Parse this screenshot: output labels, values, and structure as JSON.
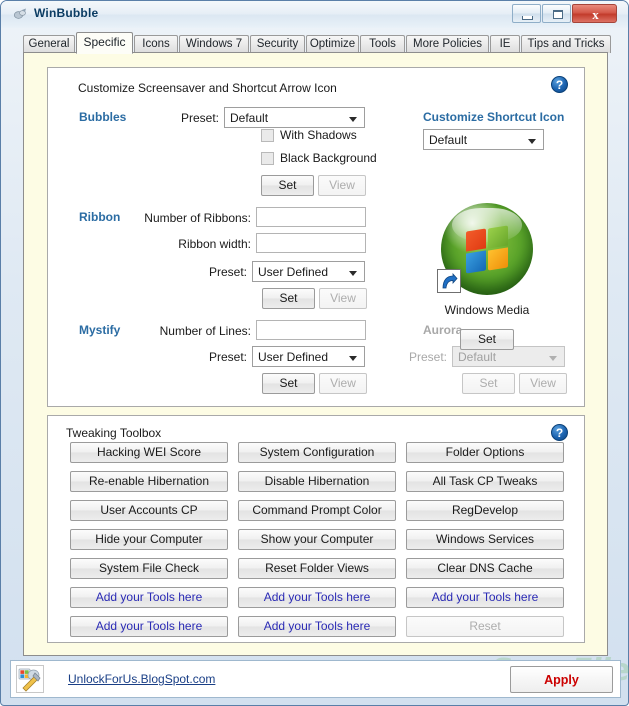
{
  "window": {
    "title": "WinBubble",
    "icon": "winbubble-app-icon",
    "controls": {
      "minimize": "minimize-icon",
      "maximize": "maximize-icon",
      "close": "x"
    }
  },
  "tabs": [
    {
      "label": "General",
      "active": false
    },
    {
      "label": "Specific",
      "active": true
    },
    {
      "label": "Icons",
      "active": false
    },
    {
      "label": "Windows 7",
      "active": false
    },
    {
      "label": "Security",
      "active": false
    },
    {
      "label": "Optimize",
      "active": false
    },
    {
      "label": "Tools",
      "active": false
    },
    {
      "label": "More Policies",
      "active": false
    },
    {
      "label": "IE",
      "active": false
    },
    {
      "label": "Tips and Tricks",
      "active": false
    }
  ],
  "screensaver_group": {
    "title": "Customize Screensaver and Shortcut Arrow Icon",
    "help": "?",
    "bubbles": {
      "label": "Bubbles",
      "preset_label": "Preset:",
      "preset_value": "Default",
      "checkboxes": [
        {
          "label": "With Shadows",
          "checked": false
        },
        {
          "label": "Black Background",
          "checked": false
        }
      ],
      "set_label": "Set",
      "view_label": "View",
      "view_disabled": true
    },
    "ribbon": {
      "label": "Ribbon",
      "count_label": "Number of Ribbons:",
      "count_value": "",
      "width_label": "Ribbon width:",
      "width_value": "",
      "preset_label": "Preset:",
      "preset_value": "User Defined",
      "set_label": "Set",
      "view_label": "View",
      "view_disabled": true
    },
    "mystify": {
      "label": "Mystify",
      "lines_label": "Number of Lines:",
      "lines_value": "",
      "preset_label": "Preset:",
      "preset_value": "User Defined",
      "set_label": "Set",
      "view_label": "View",
      "view_disabled": true
    },
    "shortcut": {
      "label": "Customize Shortcut Icon",
      "preset_value": "Default",
      "preview_icon": "windows-media-orb-icon",
      "badge_icon": "shortcut-arrow-icon",
      "caption": "Windows Media",
      "set_label": "Set"
    },
    "aurora": {
      "label": "Aurora",
      "disabled": true,
      "preset_label": "Preset:",
      "preset_value": "Default",
      "set_label": "Set",
      "view_label": "View"
    }
  },
  "toolbox_group": {
    "title": "Tweaking Toolbox",
    "help": "?",
    "buttons": [
      {
        "label": "Hacking WEI Score",
        "style": "normal"
      },
      {
        "label": "System Configuration",
        "style": "normal"
      },
      {
        "label": "Folder Options",
        "style": "normal"
      },
      {
        "label": "Re-enable Hibernation",
        "style": "normal"
      },
      {
        "label": "Disable Hibernation",
        "style": "normal"
      },
      {
        "label": "All Task CP Tweaks",
        "style": "normal"
      },
      {
        "label": "User Accounts CP",
        "style": "normal"
      },
      {
        "label": "Command Prompt Color",
        "style": "normal"
      },
      {
        "label": "RegDevelop",
        "style": "normal"
      },
      {
        "label": "Hide your Computer",
        "style": "normal"
      },
      {
        "label": "Show your Computer",
        "style": "normal"
      },
      {
        "label": "Windows Services",
        "style": "normal"
      },
      {
        "label": "System File Check",
        "style": "normal"
      },
      {
        "label": "Reset Folder Views",
        "style": "normal"
      },
      {
        "label": "Clear DNS Cache",
        "style": "normal"
      },
      {
        "label": "Add your Tools here",
        "style": "link"
      },
      {
        "label": "Add your Tools here",
        "style": "link"
      },
      {
        "label": "Add your Tools here",
        "style": "link"
      },
      {
        "label": "Add your Tools here",
        "style": "link"
      },
      {
        "label": "Add your Tools here",
        "style": "link"
      },
      {
        "label": "Reset",
        "style": "disabled"
      }
    ]
  },
  "watermark": "SnapFiles",
  "footer": {
    "icon": "winbubble-tools-icon",
    "link": "UnlockForUs.BlogSpot.com",
    "apply_label": "Apply",
    "apply_color": "#cc0000"
  }
}
